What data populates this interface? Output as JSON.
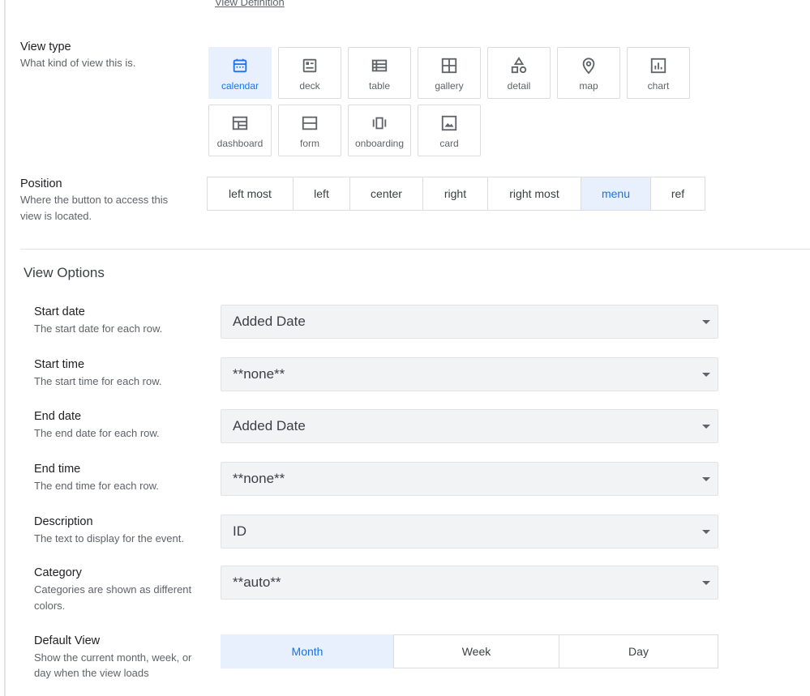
{
  "header": {
    "view_definition_link": "View Definition"
  },
  "view_type": {
    "label": "View type",
    "description": "What kind of view this is.",
    "selected": "calendar",
    "accent_color": "#1a73e8",
    "tiles": [
      {
        "label": "calendar",
        "icon": "calendar-icon"
      },
      {
        "label": "deck",
        "icon": "deck-icon"
      },
      {
        "label": "table",
        "icon": "table-icon"
      },
      {
        "label": "gallery",
        "icon": "gallery-icon"
      },
      {
        "label": "detail",
        "icon": "detail-icon"
      },
      {
        "label": "map",
        "icon": "map-pin-icon"
      },
      {
        "label": "chart",
        "icon": "chart-icon"
      },
      {
        "label": "dashboard",
        "icon": "dashboard-icon"
      },
      {
        "label": "form",
        "icon": "form-icon"
      },
      {
        "label": "onboarding",
        "icon": "onboarding-icon"
      },
      {
        "label": "card",
        "icon": "card-icon"
      }
    ]
  },
  "position": {
    "label": "Position",
    "description_line1": "Where the button to access this",
    "description_line2": "view is located.",
    "selected": "menu",
    "options": [
      "left most",
      "left",
      "center",
      "right",
      "right most",
      "menu",
      "ref"
    ]
  },
  "view_options": {
    "title": "View Options",
    "fields": [
      {
        "label": "Start date",
        "desc1": "The start date for each row.",
        "desc2": "",
        "value": "Added Date"
      },
      {
        "label": "Start time",
        "desc1": "The start time for each row.",
        "desc2": "",
        "value": "**none**"
      },
      {
        "label": "End date",
        "desc1": "The end date for each row.",
        "desc2": "",
        "value": "Added Date"
      },
      {
        "label": "End time",
        "desc1": "The end time for each row.",
        "desc2": "",
        "value": "**none**"
      },
      {
        "label": "Description",
        "desc1": "The text to display for the event.",
        "desc2": "",
        "value": "ID"
      },
      {
        "label": "Category",
        "desc1": "Categories are shown as different",
        "desc2": "colors.",
        "value": "**auto**"
      }
    ],
    "default_view": {
      "label": "Default View",
      "desc1": "Show the current month, week, or",
      "desc2": "day when the view loads",
      "selected": "Month",
      "options": [
        "Month",
        "Week",
        "Day"
      ]
    }
  }
}
